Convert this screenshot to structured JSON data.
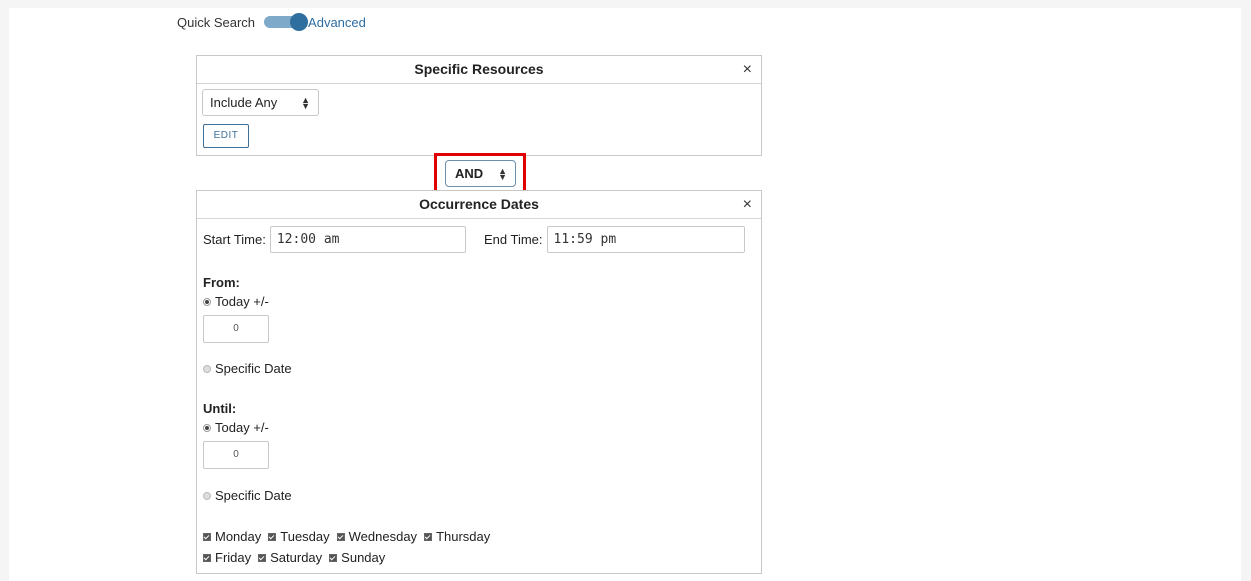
{
  "search_mode": {
    "quick_label": "Quick Search",
    "advanced_label": "Advanced",
    "advanced_on": true
  },
  "specific_resources": {
    "title": "Specific Resources",
    "close": "×",
    "include_select": "Include Any",
    "edit_label": "EDIT"
  },
  "conjunction": {
    "value": "AND"
  },
  "occurrence_dates": {
    "title": "Occurrence Dates",
    "close": "×",
    "start_time_label": "Start Time:",
    "start_time_value": "12:00 am",
    "end_time_label": "End Time:",
    "end_time_value": "11:59 pm",
    "from": {
      "label": "From:",
      "today_label": "Today +/-",
      "today_value": "0",
      "specific_label": "Specific Date",
      "selected": "today"
    },
    "until": {
      "label": "Until:",
      "today_label": "Today +/-",
      "today_value": "0",
      "specific_label": "Specific Date",
      "selected": "today"
    },
    "days": [
      {
        "label": "Monday",
        "checked": true
      },
      {
        "label": "Tuesday",
        "checked": true
      },
      {
        "label": "Wednesday",
        "checked": true
      },
      {
        "label": "Thursday",
        "checked": true
      },
      {
        "label": "Friday",
        "checked": true
      },
      {
        "label": "Saturday",
        "checked": true
      },
      {
        "label": "Sunday",
        "checked": true
      }
    ]
  },
  "colors": {
    "accent": "#2f6f9f",
    "highlight": "#e00000"
  }
}
